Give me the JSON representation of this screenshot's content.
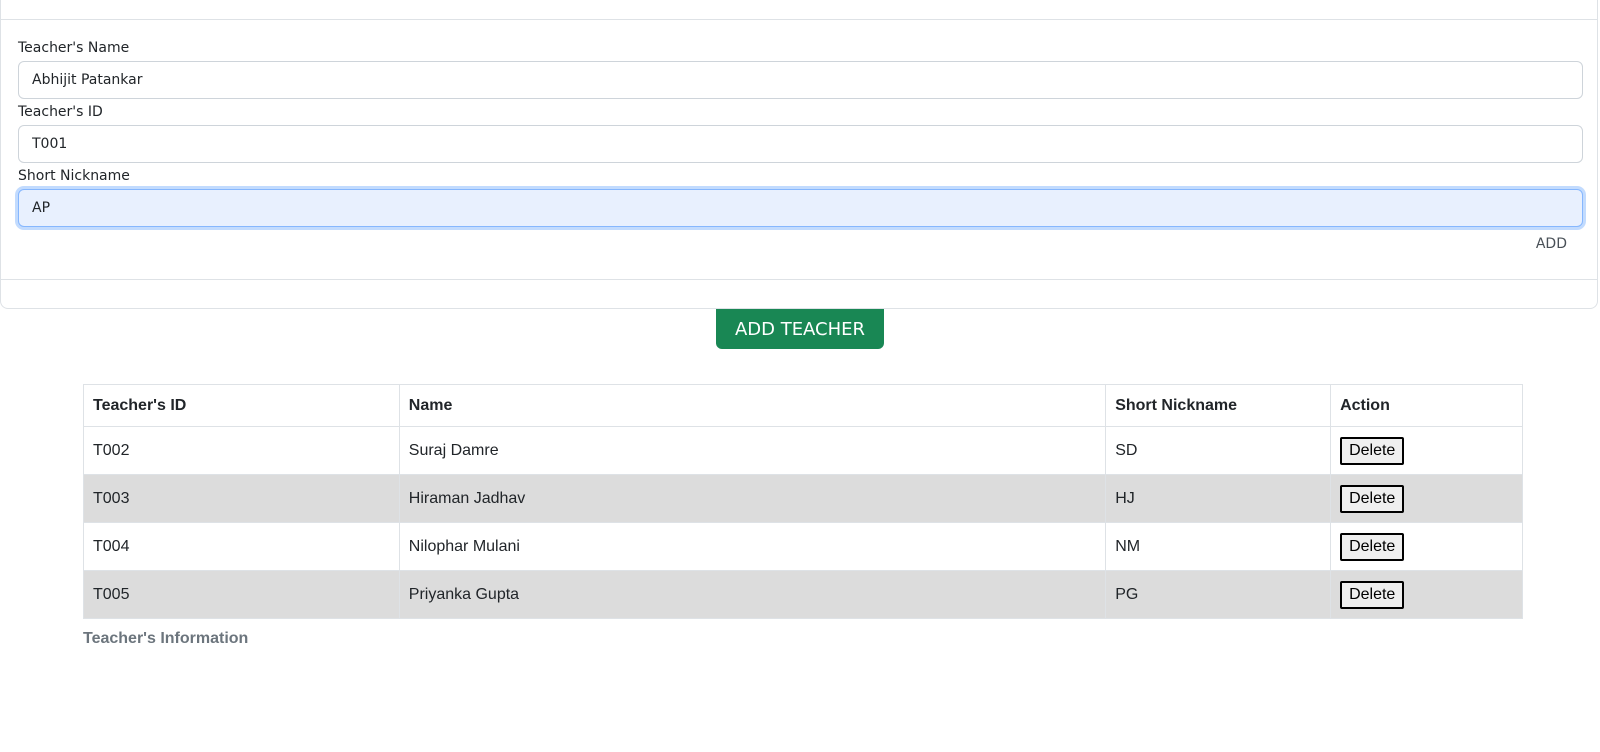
{
  "form": {
    "teacher_name_label": "Teacher's Name",
    "teacher_name_value": "Abhijit Patankar",
    "teacher_id_label": "Teacher's ID",
    "teacher_id_value": "T001",
    "nickname_label": "Short Nickname",
    "nickname_value": "AP",
    "add_label": "ADD"
  },
  "add_teacher_button": "ADD TEACHER",
  "table": {
    "headers": {
      "id": "Teacher's ID",
      "name": "Name",
      "nickname": "Short Nickname",
      "action": "Action"
    },
    "rows": [
      {
        "id": "T002",
        "name": "Suraj Damre",
        "nickname": "SD",
        "action": "Delete"
      },
      {
        "id": "T003",
        "name": "Hiraman Jadhav",
        "nickname": "HJ",
        "action": "Delete"
      },
      {
        "id": "T004",
        "name": "Nilophar Mulani",
        "nickname": "NM",
        "action": "Delete"
      },
      {
        "id": "T005",
        "name": "Priyanka Gupta",
        "nickname": "PG",
        "action": "Delete"
      }
    ],
    "caption": "Teacher's Information"
  },
  "colors": {
    "primary_button": "#198754",
    "striped_row": "#dcdcdc",
    "focused_input": "#e8f0fe"
  }
}
